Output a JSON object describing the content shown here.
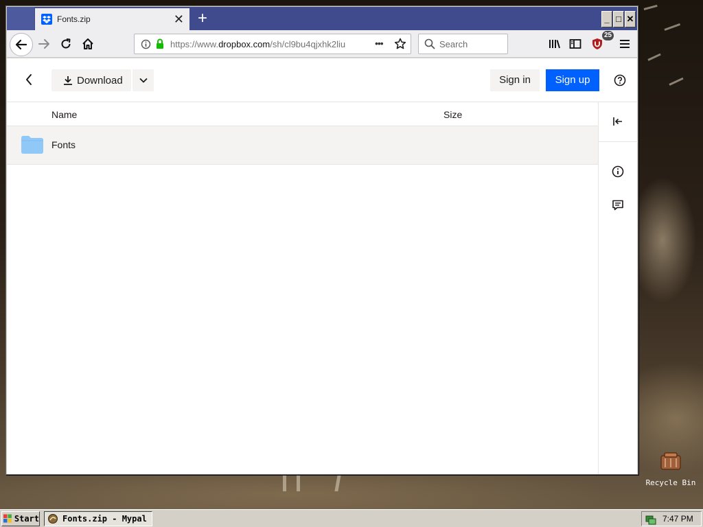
{
  "browser": {
    "tab": {
      "title": "Fonts.zip",
      "close_glyph": "✕"
    },
    "new_tab_glyph": "+",
    "window_controls": {
      "minimize": "_",
      "maximize": "□",
      "close": "✕"
    },
    "url": {
      "prefix": "https://www.",
      "host": "dropbox.com",
      "path": "/sh/cl9bu4qjxhk2liu"
    },
    "page_actions_glyph": "•••",
    "search": {
      "placeholder": "Search"
    },
    "addon_badge": "25"
  },
  "page": {
    "toolbar": {
      "download_label": "Download",
      "sign_in_label": "Sign in",
      "sign_up_label": "Sign up"
    },
    "list": {
      "columns": {
        "name": "Name",
        "size": "Size"
      },
      "items": [
        {
          "name": "Fonts",
          "size": "",
          "type": "folder"
        }
      ]
    }
  },
  "desktop": {
    "recycle_bin_label": "Recycle Bin"
  },
  "taskbar": {
    "start_label": "Start",
    "task_label": "Fonts.zip - Mypal",
    "clock": "7:47 PM"
  },
  "colors": {
    "accent": "#0061fe",
    "tab_strip": "#3f4b8c",
    "folder": "#90c9f7"
  }
}
